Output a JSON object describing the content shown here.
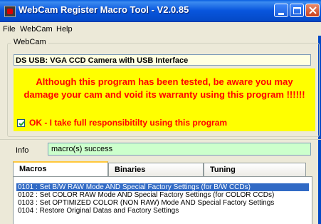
{
  "window": {
    "title": "WebCam Register Macro Tool - V2.0.85"
  },
  "menu": [
    "File",
    "WebCam",
    "Help"
  ],
  "webcam": {
    "group_label": "WebCam",
    "device": "DS USB: VGA CCD Camera with USB Interface",
    "warning_line1": "Although this program has been tested, be aware you may",
    "warning_line2": "damage your cam and void its warranty using this program !!!!!!",
    "confirm_label": "OK - I take full responsibitilty using this program",
    "confirm_checked": true
  },
  "info": {
    "label": "Info",
    "value": "macro(s) success"
  },
  "tabs": [
    "Macros",
    "Binaries",
    "Tuning"
  ],
  "active_tab": "Macros",
  "macros": [
    "0101 : Set B/W RAW Mode AND Special Factory Settings (for B/W CCDs)",
    "0102 : Set COLOR RAW Mode AND Special Factory Settings (for COLOR CCDs)",
    "0103 : Set OPTIMIZED COLOR (NON RAW) Mode AND Special Factory Settings",
    "0104 : Restore Original Datas and Factory Settings"
  ],
  "selected_macro_index": 0,
  "colors": {
    "titlebar": "#0855DD",
    "warning_bg": "#FFFF00",
    "warning_text": "#FF0000",
    "info_bg": "#CCFFCC",
    "device_bg": "#FFFFE1",
    "selection": "#316AC5"
  },
  "icons": [
    "app-icon",
    "minimize-icon",
    "maximize-icon",
    "close-icon",
    "checkmark-icon"
  ]
}
